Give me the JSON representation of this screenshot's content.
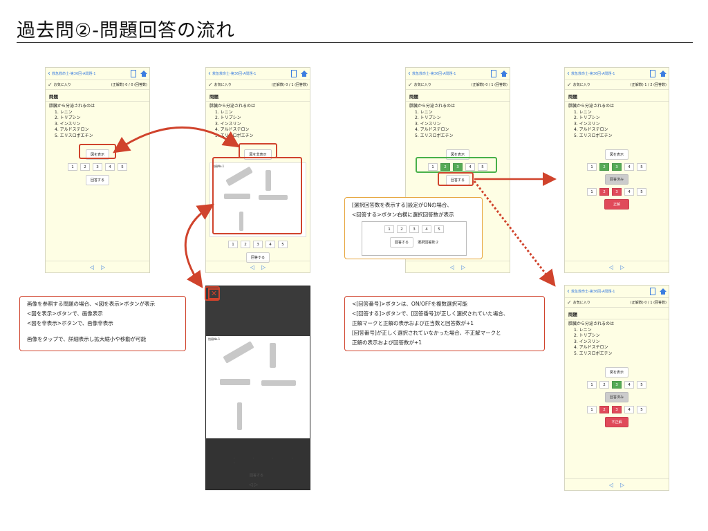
{
  "page": {
    "title": "過去問②-問題回答の流れ"
  },
  "colors": {
    "accent_red": "#d0432c",
    "accent_green": "#48b048",
    "accent_orange": "#e6a43a",
    "phone_bg": "#fefee4",
    "link_blue": "#3b7de0"
  },
  "phone": {
    "nav_title": "救急救命士-第36回-A問題-1",
    "favorite": "お気に入り",
    "question_head": "問題",
    "question": "膵臓から分泌されるのは",
    "options": [
      "1. レニン",
      "2. トリプシン",
      "3. インスリン",
      "4. アルドステロン",
      "5. エリスロポエチン"
    ],
    "show_image": "図を表示",
    "hide_image": "図を非表示",
    "answer": "回答する",
    "answered": "回答済み",
    "correct": "正解",
    "incorrect": "不正解",
    "numbers": [
      "1",
      "2",
      "3",
      "4",
      "5"
    ],
    "prev": "◁",
    "next": "▷"
  },
  "scores": {
    "s1": "(正解数) 0 / 0 (回答数)",
    "s2": "(正解数) 0 / 1 (回答数)",
    "s3": "(正解数) 0 / 1 (回答数)",
    "s4": "(正解数) 1 / 2 (回答数)",
    "s5": "(正解数) 0 / 1 (回答数)"
  },
  "dark": {
    "close": "✕",
    "figure_label": "別冊No.1"
  },
  "notes": {
    "image_note": [
      "画像を参照する問題の場合、<図を表示>ボタンが表示",
      "<図を表示>ボタンで、画像表示",
      "<図を非表示>ボタンで、画像非表示",
      "",
      "画像をタップで、詳細表示し拡大縮小や移動が可能"
    ],
    "selection_note": [
      "[選択回答数を表示する]設定がONの場合、",
      "<回答する>ボタン右横に選択回答数が表示"
    ],
    "selection_count": "選択回答数:2",
    "answer_note": [
      "<[回答番号]>ボタンは、ON/OFFを複数選択可能",
      "<[回答する]>ボタンで、[回答番号]が正しく選択されていた場合、",
      "正解マークと正解の表示および正当数と回答数が+1",
      "[回答番号]が正しく選択されていなかった場合、不正解マークと",
      "正解の表示および回答数が+1"
    ]
  }
}
